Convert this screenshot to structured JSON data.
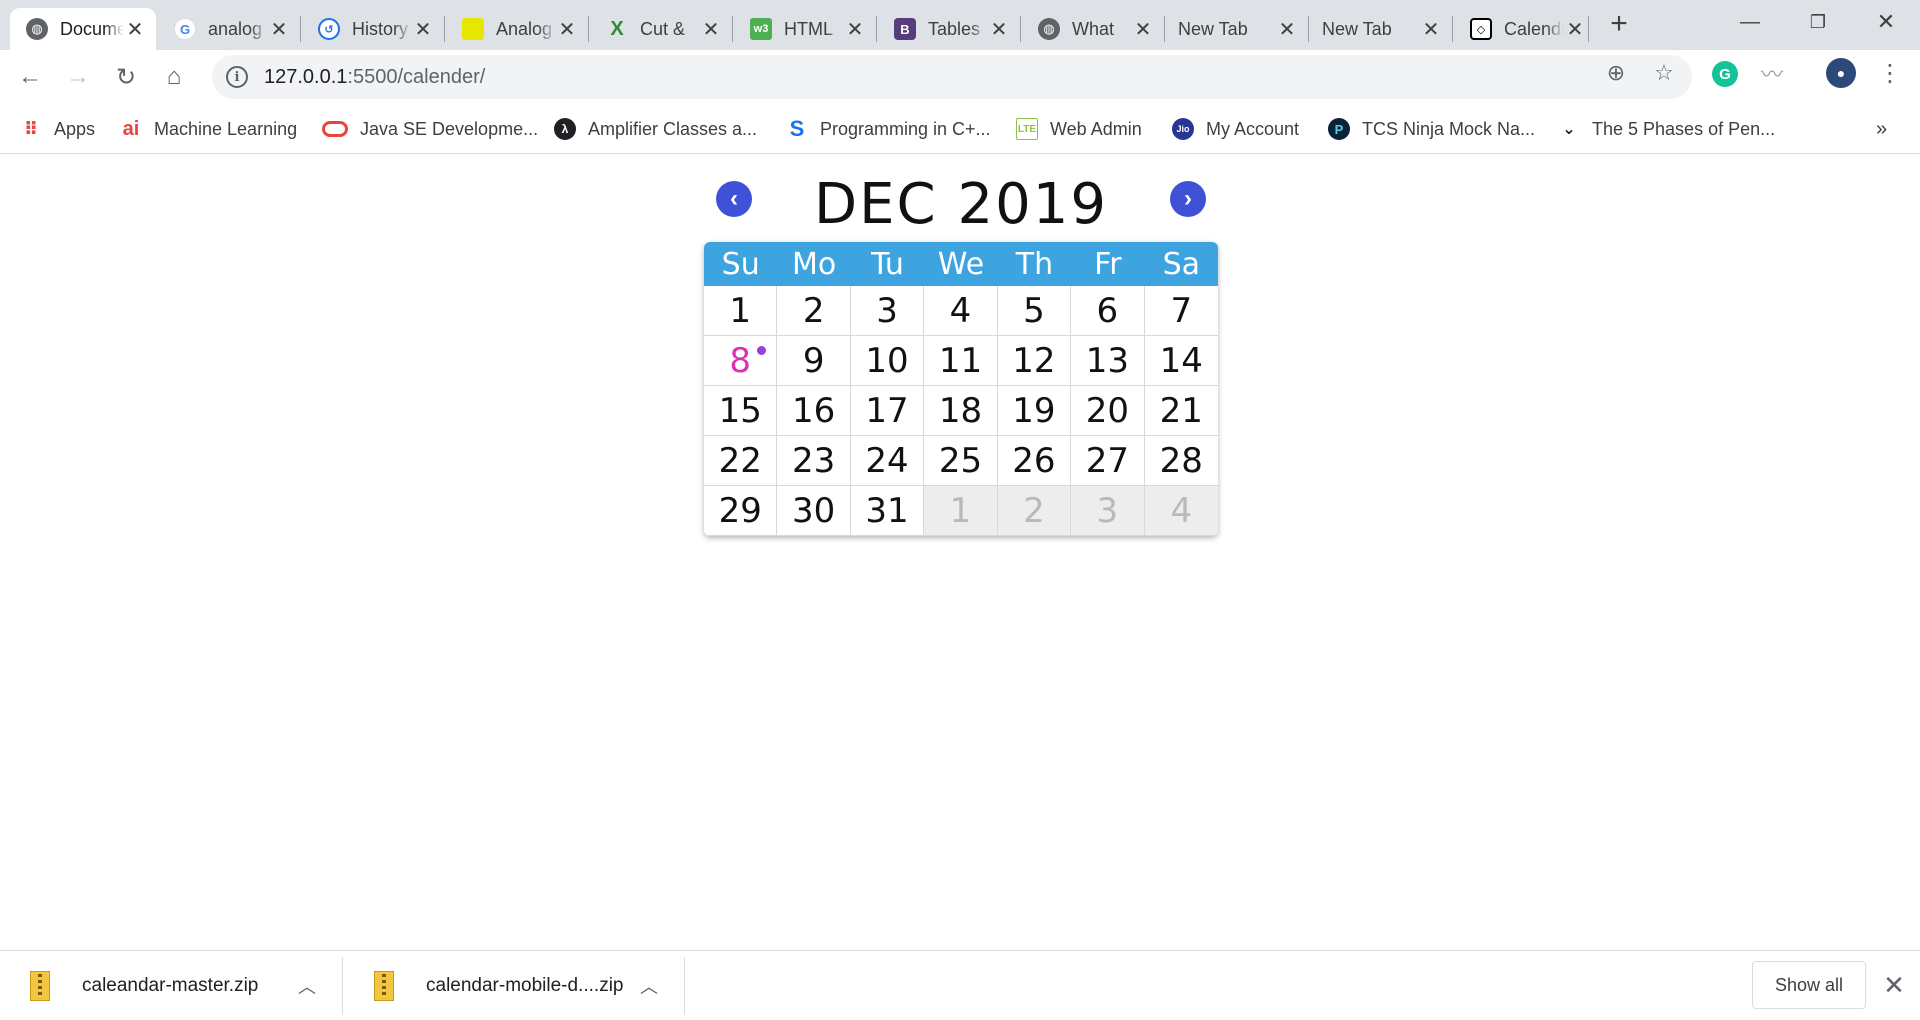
{
  "tabs": [
    {
      "label": "Document",
      "icon": "globe-icon",
      "active": true
    },
    {
      "label": "analog",
      "icon": "google-icon"
    },
    {
      "label": "History",
      "icon": "history-icon"
    },
    {
      "label": "Analog",
      "icon": "yellow-site-icon"
    },
    {
      "label": "Cut &",
      "icon": "cut-site-icon"
    },
    {
      "label": "HTML",
      "icon": "w3-icon"
    },
    {
      "label": "Tables",
      "icon": "bootstrap-icon"
    },
    {
      "label": "What",
      "icon": "globe-icon"
    },
    {
      "label": "New Tab",
      "icon": ""
    },
    {
      "label": "New Tab",
      "icon": ""
    },
    {
      "label": "Calendar",
      "icon": "codepen-icon"
    }
  ],
  "toolbar": {
    "url_host": "127.0.0.1",
    "url_rest": ":5500/calender/"
  },
  "bookmarks": [
    {
      "label": "Apps",
      "icon": "apps-grid-icon"
    },
    {
      "label": "Machine Learning",
      "icon": "ai-icon"
    },
    {
      "label": "Java SE Developme...",
      "icon": "oracle-icon"
    },
    {
      "label": "Amplifier Classes a...",
      "icon": "amplifier-icon"
    },
    {
      "label": "Programming in C+...",
      "icon": "s-icon"
    },
    {
      "label": "Web Admin",
      "icon": "lte-icon"
    },
    {
      "label": "My Account",
      "icon": "jio-icon"
    },
    {
      "label": "TCS Ninja Mock Na...",
      "icon": "tcs-icon"
    },
    {
      "label": "The 5 Phases of Pen...",
      "icon": "bookmark-icon"
    }
  ],
  "calendar": {
    "title": "DEC 2019",
    "weekdays": [
      "Su",
      "Mo",
      "Tu",
      "We",
      "Th",
      "Fr",
      "Sa"
    ],
    "days": [
      {
        "d": "1"
      },
      {
        "d": "2"
      },
      {
        "d": "3"
      },
      {
        "d": "4"
      },
      {
        "d": "5"
      },
      {
        "d": "6"
      },
      {
        "d": "7"
      },
      {
        "d": "8",
        "today": true,
        "event": true
      },
      {
        "d": "9"
      },
      {
        "d": "10"
      },
      {
        "d": "11"
      },
      {
        "d": "12"
      },
      {
        "d": "13"
      },
      {
        "d": "14"
      },
      {
        "d": "15"
      },
      {
        "d": "16"
      },
      {
        "d": "17"
      },
      {
        "d": "18"
      },
      {
        "d": "19"
      },
      {
        "d": "20"
      },
      {
        "d": "21"
      },
      {
        "d": "22"
      },
      {
        "d": "23"
      },
      {
        "d": "24"
      },
      {
        "d": "25"
      },
      {
        "d": "26"
      },
      {
        "d": "27"
      },
      {
        "d": "28"
      },
      {
        "d": "29"
      },
      {
        "d": "30"
      },
      {
        "d": "31"
      },
      {
        "d": "1",
        "other": true
      },
      {
        "d": "2",
        "other": true
      },
      {
        "d": "3",
        "other": true
      },
      {
        "d": "4",
        "other": true
      }
    ],
    "accent": "#3da4e0",
    "today_color": "#e030b0"
  },
  "downloads": [
    {
      "filename": "caleandar-master.zip"
    },
    {
      "filename": "calendar-mobile-d....zip"
    }
  ],
  "shelf": {
    "show_all": "Show all"
  }
}
